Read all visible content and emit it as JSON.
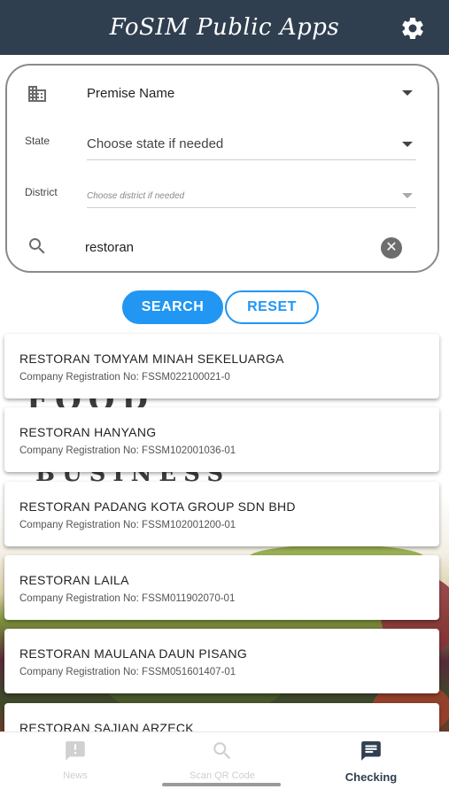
{
  "header": {
    "title": "FoSIM Public Apps",
    "settings_icon": "gear-icon"
  },
  "filters": {
    "premise": {
      "icon": "building-icon",
      "selected": "Premise Name"
    },
    "state": {
      "label": "State",
      "placeholder": "Choose state if needed"
    },
    "district": {
      "label": "District",
      "placeholder": "Choose district if needed"
    },
    "search": {
      "icon": "search-icon",
      "value": "restoran",
      "clear_icon": "clear-icon"
    }
  },
  "buttons": {
    "search_label": "SEARCH",
    "reset_label": "RESET"
  },
  "results": [
    {
      "name": "RESTORAN TOMYAM MINAH SEKELUARGA",
      "reg": "Company Registration No: FSSM022100021-0"
    },
    {
      "name": "RESTORAN HANYANG",
      "reg": "Company Registration No: FSSM102001036-01"
    },
    {
      "name": "RESTORAN PADANG KOTA GROUP SDN BHD",
      "reg": "Company Registration No: FSSM102001200-01"
    },
    {
      "name": "RESTORAN LAILA",
      "reg": "Company Registration No: FSSM011902070-01"
    },
    {
      "name": "RESTORAN MAULANA DAUN PISANG",
      "reg": "Company Registration No: FSSM051601407-01"
    },
    {
      "name": "RESTORAN SAJIAN ARZECK",
      "reg": ""
    }
  ],
  "background_words": [
    "FOOD",
    "BUSINESS"
  ],
  "bottom_nav": [
    {
      "label": "News",
      "icon": "news-icon",
      "active": false
    },
    {
      "label": "Scan QR Code",
      "icon": "qr-search-icon",
      "active": false
    },
    {
      "label": "Checking",
      "icon": "checking-icon",
      "active": true
    }
  ],
  "colors": {
    "header": "#2f3f50",
    "accent": "#2196f3"
  }
}
